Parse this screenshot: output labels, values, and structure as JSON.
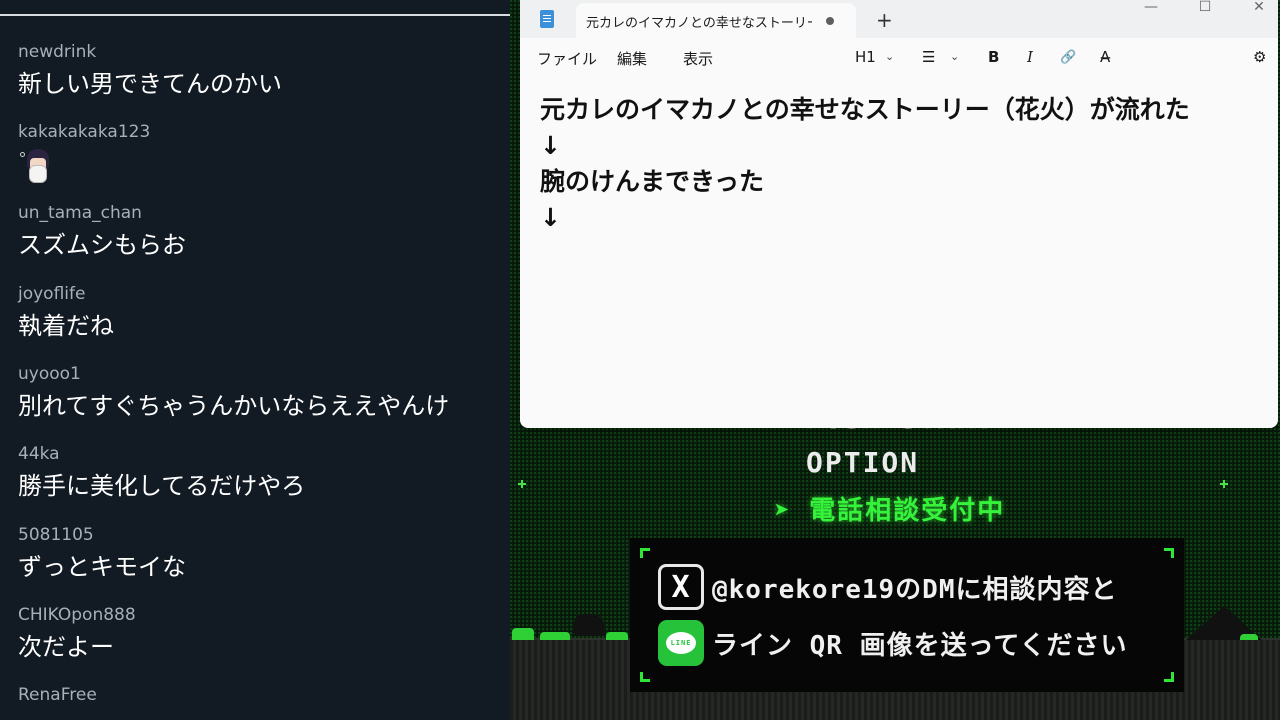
{
  "chat": {
    "messages": [
      {
        "user": "newdrink",
        "text": "新しい男できてんのかい"
      },
      {
        "user": "kakakakaka123",
        "text": ""
      },
      {
        "user": "un_tama_chan",
        "text": "スズムシもらお"
      },
      {
        "user": "joyoflife",
        "text": "執着だね"
      },
      {
        "user": "uyooo1",
        "text": "別れてすぐちゃうんかいならええやんけ"
      },
      {
        "user": "44ka",
        "text": "勝手に美化してるだけやろ"
      },
      {
        "user": "5081105",
        "text": "ずっとキモイな"
      },
      {
        "user": "CHIKOpon888",
        "text": "次だよー"
      },
      {
        "user": "RenaFree",
        "text": ""
      }
    ]
  },
  "notepad": {
    "tab_title": "元カレのイマカノとの幸せなストーリー（花",
    "new_tab": "+",
    "window_controls": {
      "minimize": "—",
      "maximize": "☐",
      "close": "✕"
    },
    "menu": {
      "file": "ファイル",
      "edit": "編集",
      "view": "表示"
    },
    "toolbar": {
      "heading": "H1",
      "list": "☰",
      "bold": "B",
      "italic": "I",
      "link": "🔗",
      "spell": "A̶",
      "settings": "⚙",
      "chevron": "⌄"
    },
    "lines": [
      "元カレのイマカノとの幸せなストーリー（花火）が流れた",
      "↓",
      "腕のけんまできった",
      "↓"
    ]
  },
  "game": {
    "cut_text": "PUSH START",
    "option": "OPTION",
    "consult": "➤ 電話相談受付中",
    "x_logo": "X",
    "x_text": "@korekore19のDMに相談内容と",
    "line_logo": "LINE",
    "line_text": "ライン QR 画像を送ってください",
    "colors": {
      "accent_green": "#2ee636",
      "bg": "#08190b"
    }
  }
}
